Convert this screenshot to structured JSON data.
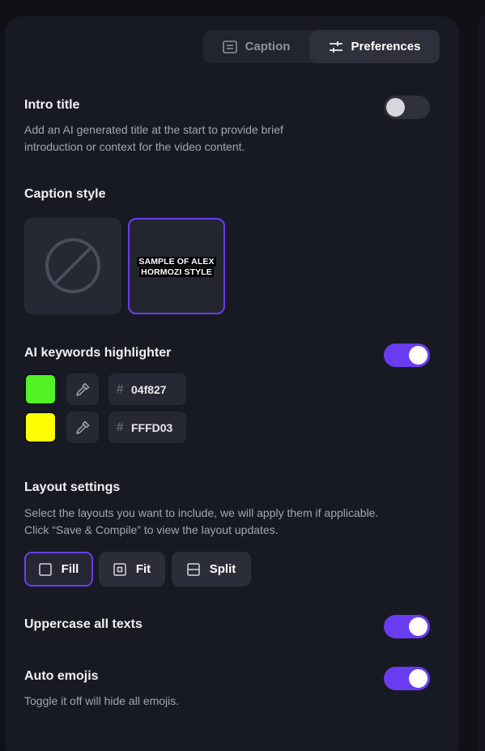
{
  "tabs": {
    "caption": "Caption",
    "preferences": "Preferences"
  },
  "intro_title": {
    "heading": "Intro title",
    "desc1": "Add an AI generated title at the start to provide brief",
    "desc2": "introduction or context for the video content.",
    "enabled": false
  },
  "caption_style": {
    "heading": "Caption style",
    "options": [
      {
        "id": "none",
        "icon": "no-style-icon"
      },
      {
        "id": "hormozi",
        "line1": "SAMPLE OF ALEX",
        "line2": "HORMOZI STYLE",
        "selected": true
      }
    ]
  },
  "keywords": {
    "heading": "AI keywords highlighter",
    "enabled": true,
    "colors": [
      {
        "hex": "04f827",
        "swatch": "#52f227"
      },
      {
        "hex": "FFFD03",
        "swatch": "#fdfd03"
      }
    ],
    "hash": "#",
    "picker_icon": "eyedropper-icon"
  },
  "layout": {
    "heading": "Layout settings",
    "desc1": "Select the layouts you want to include, we will apply them if applicable.",
    "desc2": "Click “Save & Compile” to view the layout updates.",
    "options": [
      {
        "label": "Fill",
        "icon": "fill-square-icon",
        "selected": true
      },
      {
        "label": "Fit",
        "icon": "fit-square-icon",
        "selected": false
      },
      {
        "label": "Split",
        "icon": "split-square-icon",
        "selected": false
      }
    ]
  },
  "uppercase": {
    "heading": "Uppercase all texts",
    "enabled": true
  },
  "emojis": {
    "heading": "Auto emojis",
    "desc": "Toggle it off will hide all emojis.",
    "enabled": true
  },
  "colors": {
    "accent": "#6a3cf1",
    "panel": "#181a23",
    "background": "#101117"
  }
}
